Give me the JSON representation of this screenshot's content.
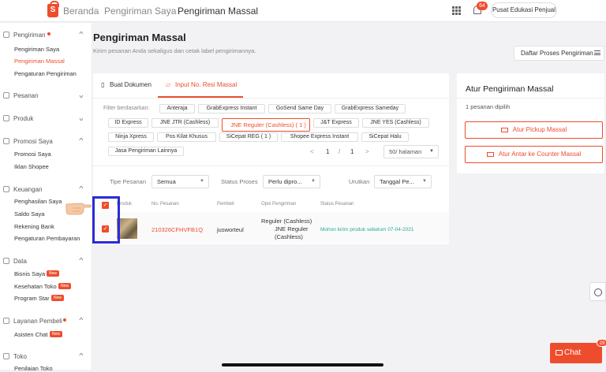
{
  "brand": {
    "accent": "#ee4d2d",
    "highlight": "#2b2bd8"
  },
  "topbar": {
    "logo_letter": "S",
    "breadcrumbs": [
      "Beranda",
      "Pengiriman Saya",
      "Pengiriman Massal"
    ],
    "notification_count": "64",
    "edukasi_label": "Pusat Edukasi Penjual"
  },
  "sidebar": {
    "pengiriman": {
      "title": "Pengiriman",
      "items": [
        "Pengiriman Saya",
        "Pengiriman Massal",
        "Pengaturan Pengiriman"
      ]
    },
    "pesanan": {
      "title": "Pesanan"
    },
    "produk": {
      "title": "Produk"
    },
    "promosi": {
      "title": "Promosi Saya",
      "items": [
        "Promosi Saya",
        "Iklan Shopee"
      ]
    },
    "keuangan": {
      "title": "Keuangan",
      "items": [
        "Penghasilan Saya",
        "Saldo Saya",
        "Rekening Bank",
        "Pengaturan Pembayaran"
      ]
    },
    "data": {
      "title": "Data",
      "items": [
        "Bisnis Saya",
        "Kesehatan Toko",
        "Program Star"
      ]
    },
    "layanan": {
      "title": "Layanan Pembeli",
      "items": [
        "Asisten Chat"
      ]
    },
    "toko": {
      "title": "Toko",
      "items": [
        "Penilaian Toko"
      ]
    },
    "new_badge": "New"
  },
  "page": {
    "title": "Pengiriman Massal",
    "subtitle": "Kirim pesanan Anda sekaligus dan cetak label pengirimannya.",
    "daftar_button": "Daftar Proses Pengiriman"
  },
  "tabs": [
    "Buat Dokumen",
    "Input No. Resi Massal"
  ],
  "filter": {
    "label": "Filter berdasarkan:",
    "chips": [
      "Anteraja",
      "GrabExpress Instant",
      "GoSend Same Day",
      "GrabExpress Sameday",
      "ID Express",
      "JNE JTR (Cashless)",
      "JNE Reguler (Cashless)  ( 1 )",
      "J&T Express",
      "JNE YES (Cashless)",
      "Ninja Xpress",
      "Pos Kilat Khusus",
      "SiCepat REG  ( 1 )",
      "Shopee Express Instant",
      "SiCepat Halu",
      "Jasa Pengiriman Lainnya"
    ]
  },
  "pagination": {
    "prev": "<",
    "current": "1",
    "slash": "/",
    "total": "1",
    "next": ">",
    "per_page": "50/ halaman"
  },
  "filters_row": {
    "tipe_label": "Tipe Pesanan",
    "tipe_value": "Semua",
    "status_label": "Status Proses",
    "status_value": "Perlu dipro...",
    "urutkan_label": "Urutkan",
    "urutkan_value": "Tanggal Pe..."
  },
  "table": {
    "headers": [
      "Produk",
      "No. Pesanan",
      "Pembeli",
      "Opsi Pengiriman",
      "Status Pesanan"
    ],
    "row": {
      "order_no": "210326CFHVFB1Q",
      "buyer": "jusworteul",
      "shipping_1": "Reguler (Cashless)",
      "shipping_2": "JNE Reguler",
      "shipping_3": "(Cashless)",
      "status": "Mohon kirim produk sebelum 07-04-2021"
    }
  },
  "right_panel": {
    "title": "Atur Pengiriman Massal",
    "count": "1 pesanan dipilih",
    "pickup_button": "Atur Pickup Massal",
    "counter_button": "Atur Antar ke Counter Massal"
  },
  "chat": {
    "label": "Chat",
    "badge": "29"
  }
}
